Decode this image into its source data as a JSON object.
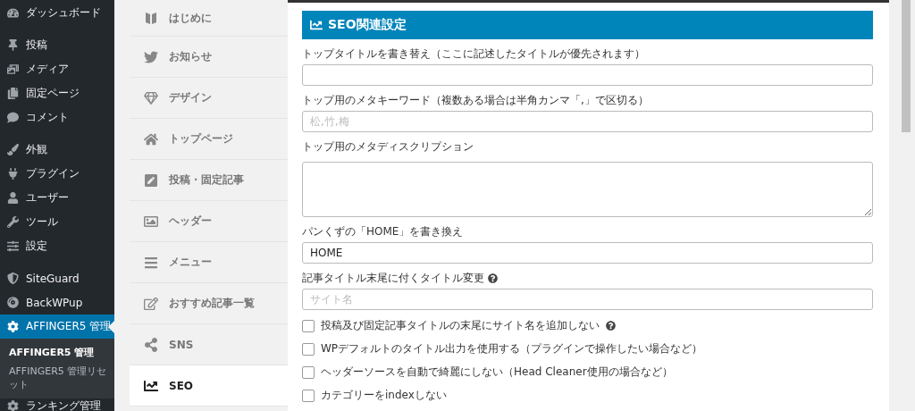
{
  "admin_menu": {
    "groups": [
      [
        {
          "label": "ダッシュボード",
          "selected": false
        }
      ],
      [
        {
          "label": "投稿",
          "selected": false
        },
        {
          "label": "メディア",
          "selected": false
        },
        {
          "label": "固定ページ",
          "selected": false
        },
        {
          "label": "コメント",
          "selected": false
        }
      ],
      [
        {
          "label": "外観",
          "selected": false
        },
        {
          "label": "プラグイン",
          "selected": false
        },
        {
          "label": "ユーザー",
          "selected": false
        },
        {
          "label": "ツール",
          "selected": false
        },
        {
          "label": "設定",
          "selected": false
        }
      ],
      [
        {
          "label": "SiteGuard",
          "selected": false
        },
        {
          "label": "BackWPup",
          "selected": false
        },
        {
          "label": "AFFINGER5 管理",
          "selected": true
        }
      ]
    ],
    "submenu": [
      {
        "label": "AFFINGER5 管理",
        "selected": true
      },
      {
        "label": "AFFINGER5 管理リセット",
        "selected": false
      }
    ],
    "after": [
      {
        "label": "ランキング管理",
        "selected": false
      }
    ]
  },
  "tabs": [
    {
      "label": "はじめに",
      "selected": false
    },
    {
      "label": "お知らせ",
      "selected": false
    },
    {
      "label": "デザイン",
      "selected": false
    },
    {
      "label": "トップページ",
      "selected": false
    },
    {
      "label": "投稿・固定記事",
      "selected": false
    },
    {
      "label": "ヘッダー",
      "selected": false
    },
    {
      "label": "メニュー",
      "selected": false
    },
    {
      "label": "おすすめ記事一覧",
      "selected": false
    },
    {
      "label": "SNS",
      "selected": false
    },
    {
      "label": "SEO",
      "selected": true
    }
  ],
  "panel": {
    "title": "SEO関連設定",
    "fields": [
      {
        "kind": "text",
        "label": "トップタイトルを書き替え（ここに記述したタイトルが優先されます）"
      },
      {
        "kind": "text",
        "label": "トップ用のメタキーワード（複数ある場合は半角カンマ「,」で区切る）",
        "placeholder": "松,竹,梅"
      },
      {
        "kind": "textarea",
        "label": "トップ用のメタディスクリプション"
      },
      {
        "kind": "text",
        "label": "パンくずの「HOME」を書き換え",
        "value": "HOME"
      },
      {
        "kind": "text",
        "label": "記事タイトル末尾に付くタイトル変更",
        "help": true,
        "placeholder": "サイト名"
      },
      {
        "kind": "checkbox",
        "label": "投稿及び固定記事タイトルの末尾にサイト名を追加しない",
        "help": true,
        "checked": false
      },
      {
        "kind": "checkbox",
        "label": "WPデフォルトのタイトル出力を使用する（プラグインで操作したい場合など）",
        "checked": false
      },
      {
        "kind": "checkbox",
        "label": "ヘッダーソースを自動で綺麗にしない（Head Cleaner使用の場合など）",
        "checked": false
      },
      {
        "kind": "checkbox",
        "label": "カテゴリーをindexしない",
        "checked": false
      }
    ]
  }
}
